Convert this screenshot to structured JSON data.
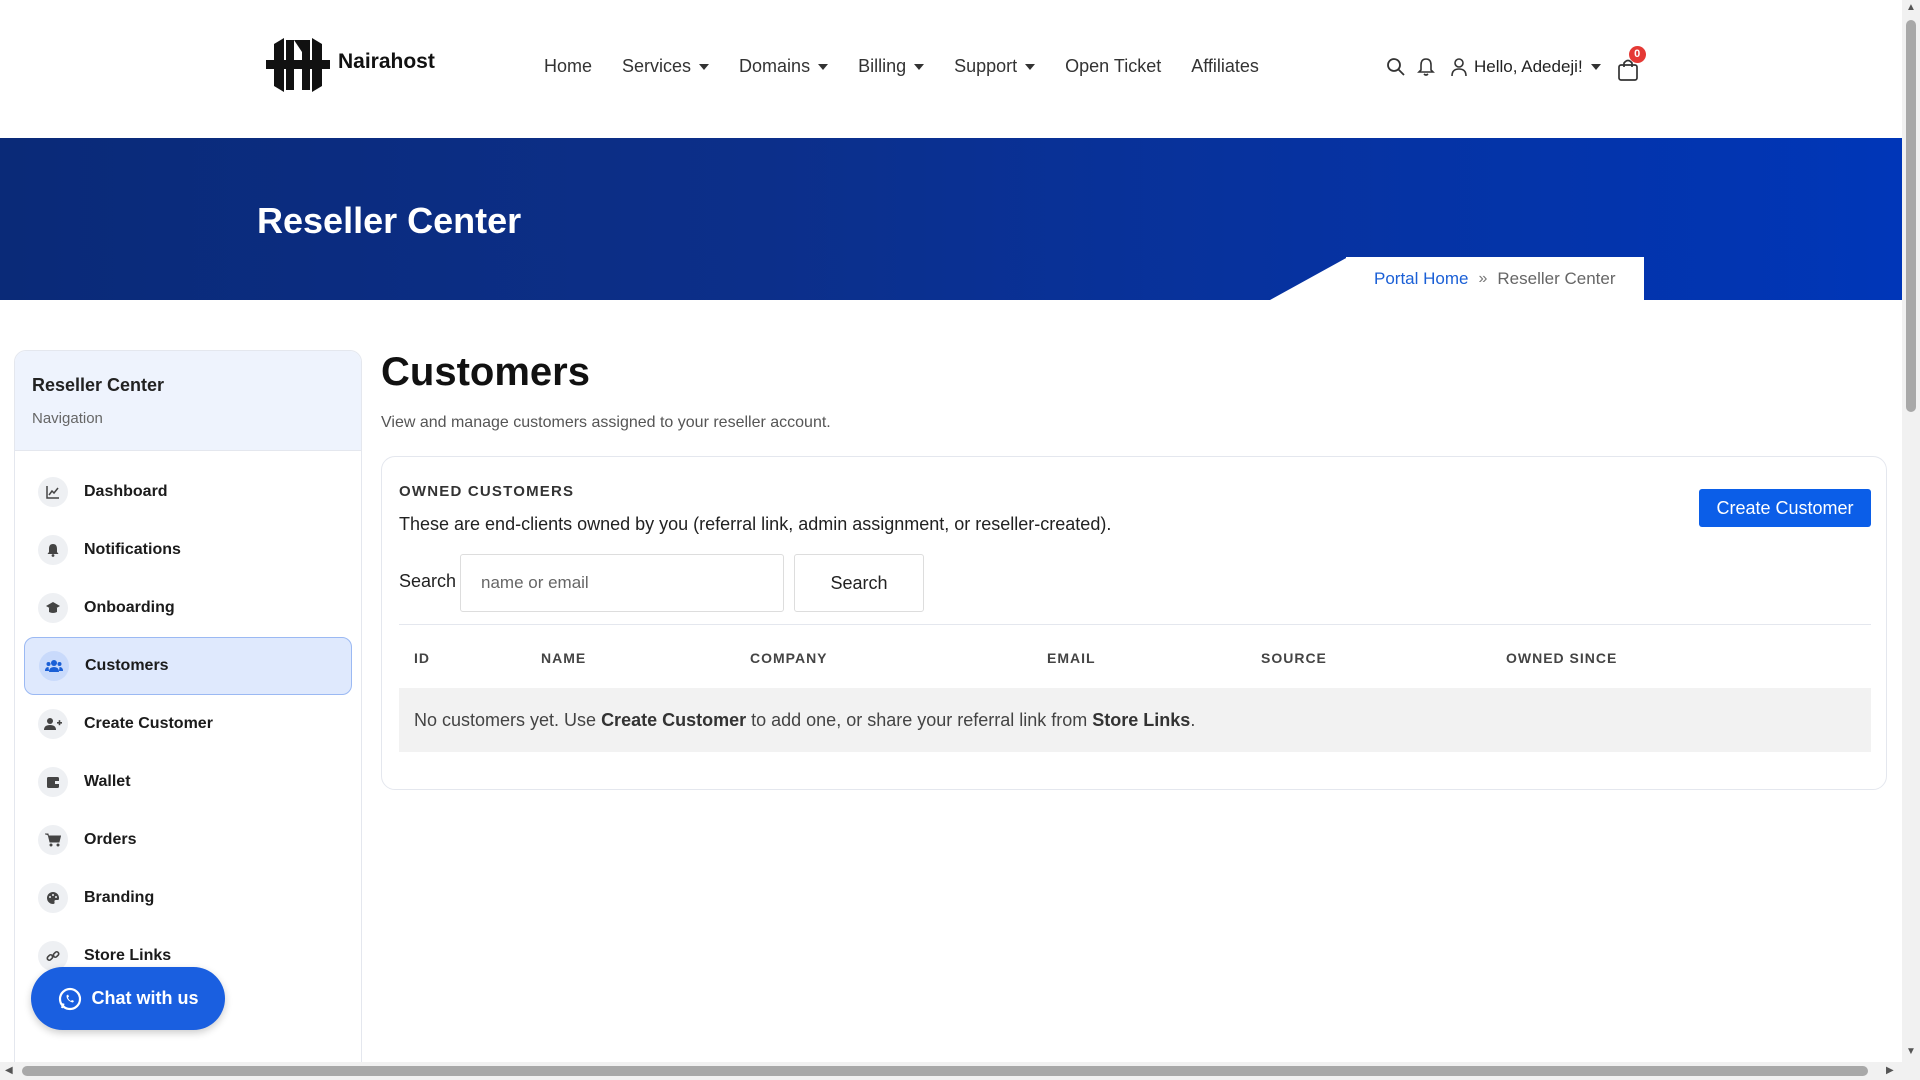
{
  "brand": {
    "name": "Nairahost"
  },
  "nav": {
    "items": [
      {
        "label": "Home",
        "dropdown": false
      },
      {
        "label": "Services",
        "dropdown": true
      },
      {
        "label": "Domains",
        "dropdown": true
      },
      {
        "label": "Billing",
        "dropdown": true
      },
      {
        "label": "Support",
        "dropdown": true
      },
      {
        "label": "Open Ticket",
        "dropdown": false
      },
      {
        "label": "Affiliates",
        "dropdown": false
      }
    ],
    "greeting": "Hello, Adedeji!",
    "cart_count": "0"
  },
  "hero": {
    "title": "Reseller Center",
    "breadcrumb": {
      "home": "Portal Home",
      "separator": "»",
      "current": "Reseller Center"
    }
  },
  "sidebar": {
    "title": "Reseller Center",
    "subtitle": "Navigation",
    "items": [
      {
        "label": "Dashboard",
        "icon": "chart-line-icon",
        "active": false
      },
      {
        "label": "Notifications",
        "icon": "bell-icon",
        "active": false
      },
      {
        "label": "Onboarding",
        "icon": "graduation-cap-icon",
        "active": false
      },
      {
        "label": "Customers",
        "icon": "users-icon",
        "active": true
      },
      {
        "label": "Create Customer",
        "icon": "user-plus-icon",
        "active": false
      },
      {
        "label": "Wallet",
        "icon": "wallet-icon",
        "active": false
      },
      {
        "label": "Orders",
        "icon": "cart-icon",
        "active": false
      },
      {
        "label": "Branding",
        "icon": "palette-icon",
        "active": false
      },
      {
        "label": "Store Links",
        "icon": "link-icon",
        "active": false
      }
    ]
  },
  "chat": {
    "label": "Chat with us",
    "icon": "whatsapp-icon"
  },
  "main": {
    "title": "Customers",
    "subtitle": "View and manage customers assigned to your reseller account.",
    "card": {
      "kicker": "OWNED CUSTOMERS",
      "description": "These are end-clients owned by you (referral link, admin assignment, or reseller-created).",
      "create_button": "Create Customer",
      "search_label": "Search",
      "search_placeholder": "name or email",
      "search_button": "Search",
      "columns": [
        "ID",
        "NAME",
        "COMPANY",
        "EMAIL",
        "SOURCE",
        "OWNED SINCE"
      ],
      "empty": {
        "pre": "No customers yet. Use ",
        "link1": "Create Customer",
        "mid": " to add one, or share your referral link from ",
        "link2": "Store Links",
        "post": "."
      }
    }
  },
  "colors": {
    "primary": "#0b5ee8",
    "hero_start": "#0a2a78",
    "hero_end": "#0036b8",
    "badge": "#e53935"
  }
}
